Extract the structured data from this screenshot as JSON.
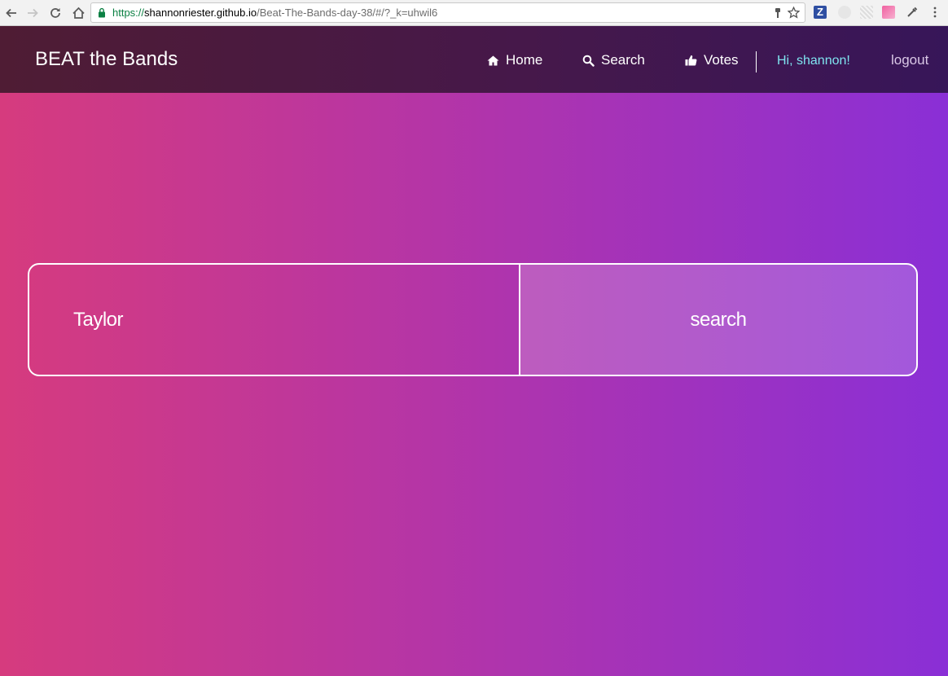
{
  "browser": {
    "url_scheme": "https://",
    "url_host": "shannonriester.github.io",
    "url_path": "/Beat-The-Bands-day-38/#/?_k=uhwil6",
    "zotero_letter": "Z"
  },
  "navbar": {
    "brand": "BEAT the Bands",
    "items": [
      {
        "label": "Home",
        "icon": "home-icon"
      },
      {
        "label": "Search",
        "icon": "search-icon"
      },
      {
        "label": "Votes",
        "icon": "thumbs-up-icon"
      }
    ],
    "greeting": "Hi, shannon!",
    "logout": "logout"
  },
  "search": {
    "value": "Taylor",
    "button_label": "search"
  },
  "colors": {
    "gradient_start": "#d63b7e",
    "gradient_end": "#8a2fd6",
    "navbar_bg": "#46184a",
    "greeting_color": "#7fe3ef"
  }
}
